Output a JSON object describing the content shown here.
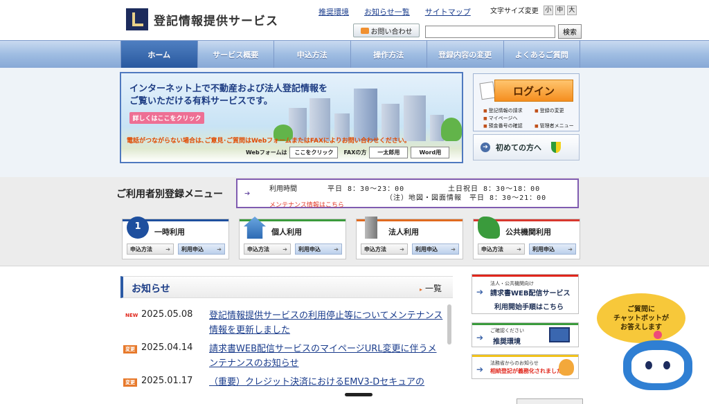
{
  "header": {
    "logo_text": "登記情報提供サービス",
    "links": [
      "推奨環境",
      "お知らせ一覧",
      "サイトマップ"
    ],
    "font_size_label": "文字サイズ変更",
    "font_sizes": [
      "小",
      "中",
      "大"
    ],
    "contact_label": "お問い合わせ",
    "search_value": "",
    "search_button": "検索"
  },
  "nav": {
    "items": [
      "ホーム",
      "サービス概要",
      "申込方法",
      "操作方法",
      "登録内容の変更",
      "よくあるご質問"
    ],
    "active_index": 0
  },
  "hero": {
    "title_line1": "インターネット上で不動産および法人登記情報を",
    "title_line2": "ご覧いただける有料サービスです。",
    "detail_button": "詳しくはここをクリック",
    "notice": "電話がつながらない場合は､ご意見･ご質問はWebフォームまたはFAXによりお問い合わせください。",
    "webform_label": "Webフォームは",
    "webform_button": "ここをクリック",
    "fax_label": "FAXの方",
    "fax_ichitaro": "一太郎用",
    "fax_word": "Word用"
  },
  "login": {
    "button": "ログイン",
    "links": [
      "登記情報の請求",
      "登録の変更",
      "マイページへ",
      "",
      "預金番号の確認",
      "管理者メニュー"
    ]
  },
  "first_time": {
    "label": "初めての方へ"
  },
  "menu": {
    "title": "ご利用者別登録メニュー",
    "hours_label": "利用時間",
    "hours_weekday": "平日 8：30～23：00",
    "hours_holiday": "土日祝日 8：30～18：00",
    "hours_map": "（注）地図・図面情報　平日 8：30～21：00",
    "maintenance": "メンテナンス情報はこちら",
    "cards": [
      {
        "title": "一時利用",
        "btn1": "申込方法",
        "btn2": "利用申込",
        "color": "#1e4f9e",
        "icon": "one-time-icon",
        "icon_text": "1"
      },
      {
        "title": "個人利用",
        "btn1": "申込方法",
        "btn2": "利用申込",
        "color": "#3a9b3c",
        "icon": "house-icon",
        "icon_text": ""
      },
      {
        "title": "法人利用",
        "btn1": "申込方法",
        "btn2": "利用申込",
        "color": "#e06a1f",
        "icon": "building-icon",
        "icon_text": ""
      },
      {
        "title": "公共機関利用",
        "btn1": "申込方法",
        "btn2": "利用申込",
        "color": "#d7372e",
        "icon": "japan-map-icon",
        "icon_text": ""
      }
    ]
  },
  "news": {
    "title": "お知らせ",
    "all_link": "一覧",
    "items": [
      {
        "badge": "NEW",
        "date": "2025.05.08",
        "text": "登記情報提供サービスの利用停止等についてメンテナンス情報を更新しました"
      },
      {
        "badge": "変更",
        "date": "2025.04.14",
        "text": "請求書WEB配信サービスのマイページURL変更に伴うメンテナンスのお知らせ"
      },
      {
        "badge": "変更",
        "date": "2025.01.17",
        "text": "（重要）クレジット決済におけるEMV3-Dセキュアの"
      }
    ]
  },
  "side": {
    "invoice_small": "法人・公共機関向け",
    "invoice_title": "請求書WEB配信サービス",
    "invoice_sub": "利用開始手順はこちら",
    "env_small": "ご確認ください",
    "env_title": "推奨環境",
    "notice_small": "法務省からのお知らせ",
    "notice_title": "相続登記が義務化されました"
  },
  "chatbot": {
    "line1": "ご質問に",
    "line2": "チャットボットが",
    "line3": "お答えします"
  }
}
